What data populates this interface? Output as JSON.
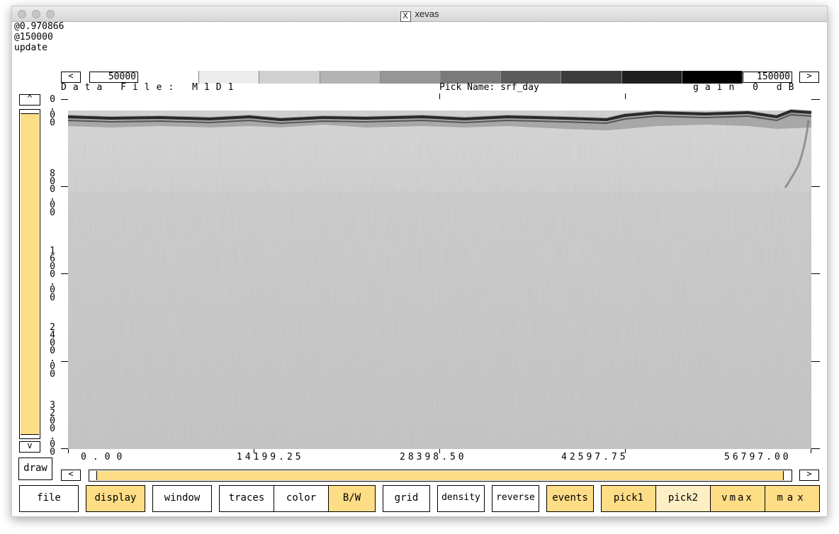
{
  "window": {
    "title": "xevas"
  },
  "console": {
    "line1": "@0.970866",
    "line2": "@150000",
    "line3": "update"
  },
  "colorbar": {
    "min_label": "50000",
    "max_label": "150000",
    "left_arrow": "<",
    "right_arrow": ">",
    "shades": [
      "#ffffff",
      "#ececec",
      "#d0d0d0",
      "#b3b3b3",
      "#969696",
      "#7a7a7a",
      "#5c5c5c",
      "#3c3c3c",
      "#1f1f1f",
      "#000000"
    ]
  },
  "header": {
    "data_file": "Data File: M1D1",
    "pick_name": "Pick Name: srf_day",
    "gain": "gain 0 dB"
  },
  "axes": {
    "y_ticks": [
      "0\n.\n0\n0",
      "8\n0\n0\n.\n0\n0",
      "1\n6\n0\n0\n.\n0\n0",
      "2\n4\n0\n0\n.\n0\n0",
      "3\n2\n0\n0\n.\n0\n0"
    ],
    "x_ticks": [
      "0.00",
      "14199.25",
      "28398.50",
      "42597.75",
      "56797.00"
    ]
  },
  "vscroll": {
    "up": "^",
    "down": "v",
    "draw_label": "draw"
  },
  "hscroll": {
    "left": "<",
    "right": ">"
  },
  "buttons": [
    {
      "id": "file",
      "label": "file"
    },
    {
      "id": "display",
      "label": "display"
    },
    {
      "id": "window",
      "label": "window"
    },
    {
      "id": "traces",
      "label": "traces"
    },
    {
      "id": "color",
      "label": "color"
    },
    {
      "id": "bw",
      "label": "B/W"
    },
    {
      "id": "grid",
      "label": "grid"
    },
    {
      "id": "density",
      "label": "density"
    },
    {
      "id": "reverse",
      "label": "reverse"
    },
    {
      "id": "events",
      "label": "events"
    },
    {
      "id": "pick1",
      "label": "pick1"
    },
    {
      "id": "pick2",
      "label": "pick2"
    },
    {
      "id": "vmax",
      "label": "vmax"
    },
    {
      "id": "max",
      "label": "max"
    }
  ],
  "colors": {
    "accent": "#fedd87",
    "accent_light": "#fdefc3"
  }
}
